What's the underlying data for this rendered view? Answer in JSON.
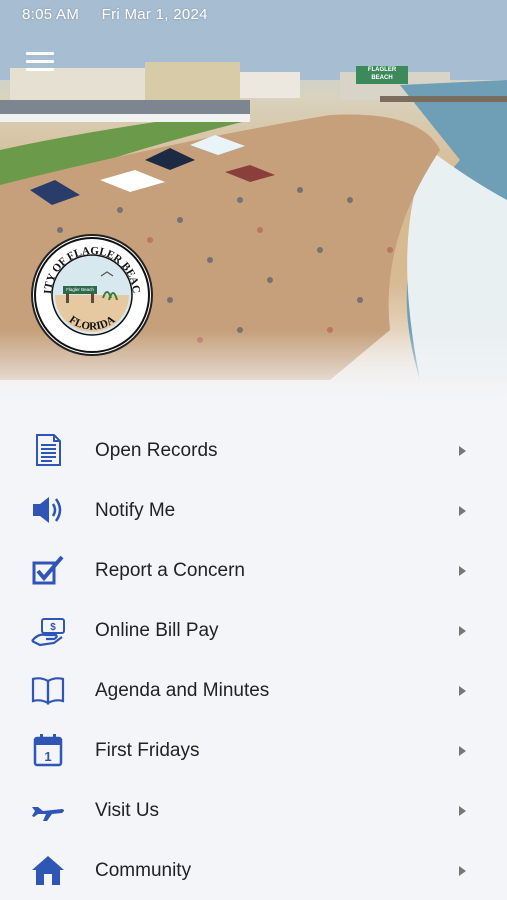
{
  "status": {
    "time": "8:05 AM",
    "date": "Fri Mar 1, 2024"
  },
  "header": {
    "menu_icon": "hamburger-menu-icon"
  },
  "hero": {
    "pier_sign": "FLAGLER BEACH",
    "seal": {
      "top_text": "CITY OF FLAGLER BEACH",
      "bottom_text": "FLORIDA",
      "inner_sign": "Flagler Beach"
    }
  },
  "colors": {
    "icon_blue": "#2f55b5",
    "text": "#222222",
    "background": "#f4f5f8",
    "chevron": "#777777"
  },
  "menu": {
    "items": [
      {
        "label": "Open Records",
        "icon": "document-icon"
      },
      {
        "label": "Notify Me",
        "icon": "speaker-icon"
      },
      {
        "label": "Report a Concern",
        "icon": "checkbox-icon"
      },
      {
        "label": "Online Bill Pay",
        "icon": "money-hand-icon"
      },
      {
        "label": "Agenda and Minutes",
        "icon": "open-book-icon"
      },
      {
        "label": "First Fridays",
        "icon": "calendar-icon"
      },
      {
        "label": "Visit Us",
        "icon": "airplane-icon"
      },
      {
        "label": "Community",
        "icon": "house-icon"
      }
    ]
  }
}
